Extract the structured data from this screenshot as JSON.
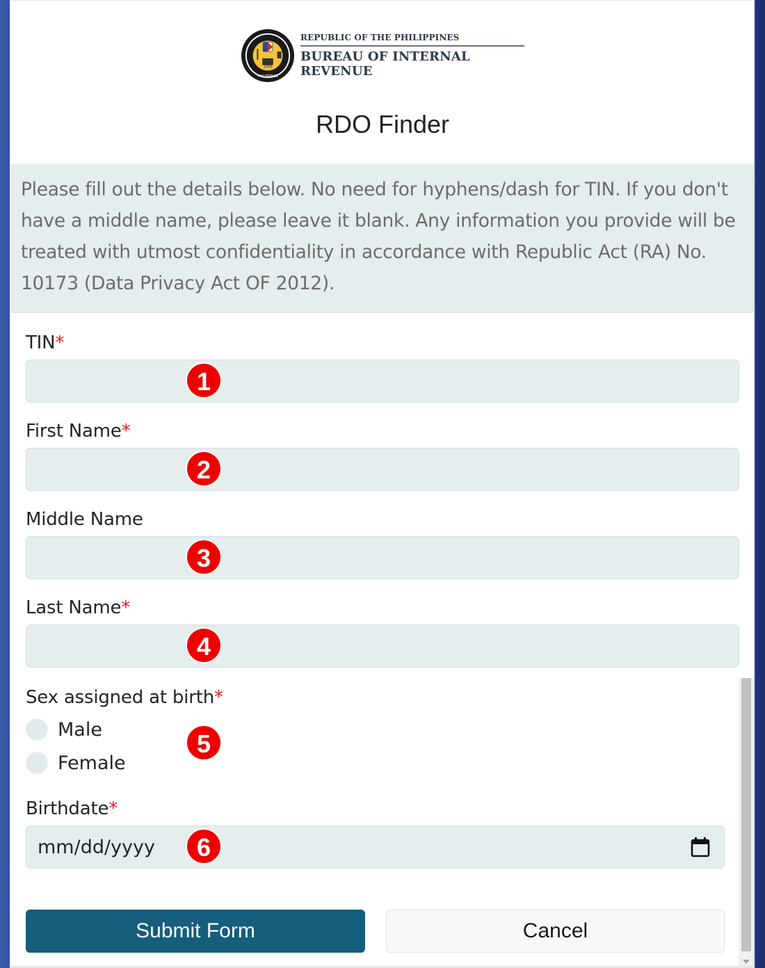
{
  "header": {
    "logo_icon": "bir-seal-icon",
    "republic": "REPUBLIC OF THE PHILIPPINES",
    "agency": "BUREAU OF INTERNAL REVENUE"
  },
  "page_title": "RDO Finder",
  "notice": "Please fill out the details below. No need for hyphens/dash for TIN. If you don't have a middle name, please leave it blank. Any information you provide will be treated with utmost confidentiality in accordance with Republic Act (RA) No. 10173 (Data Privacy Act OF 2012).",
  "form": {
    "required_marker": "*",
    "tin": {
      "label": "TIN",
      "value": "",
      "badge": "1"
    },
    "first_name": {
      "label": "First Name",
      "value": "",
      "badge": "2"
    },
    "middle_name": {
      "label": "Middle Name",
      "value": "",
      "badge": "3"
    },
    "last_name": {
      "label": "Last Name",
      "value": "",
      "badge": "4"
    },
    "sex": {
      "label": "Sex assigned at birth",
      "options": [
        "Male",
        "Female"
      ],
      "badge": "5"
    },
    "birthdate": {
      "label": "Birthdate",
      "placeholder": "mm/dd/yyyy",
      "badge": "6",
      "icon": "calendar-icon"
    }
  },
  "buttons": {
    "submit": "Submit Form",
    "cancel": "Cancel"
  },
  "colors": {
    "primary": "#155e7c",
    "required": "#e31b23",
    "badge": "#ee0000",
    "field_bg": "#e5edee"
  }
}
